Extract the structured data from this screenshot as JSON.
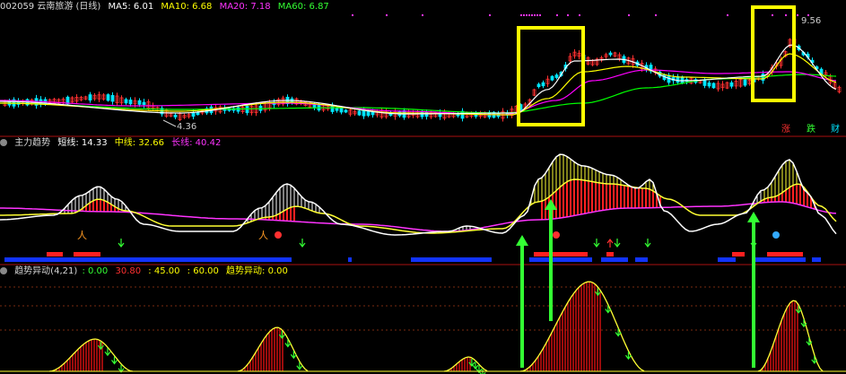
{
  "header1": {
    "code_name": "002059 云南旅游 (日线)",
    "ma5": "MA5: 6.01",
    "ma10": "MA10: 6.68",
    "ma20": "MA20: 7.18",
    "ma60": "MA60: 6.87"
  },
  "header2": {
    "name": "主力趋势",
    "short": "短线: 14.33",
    "mid": "中线: 32.66",
    "long": "长线: 40.42"
  },
  "header3": {
    "name": "趋势异动(4,21)",
    "v1": ": 0.00",
    "v2": "30.80",
    "v3": ": 45.00",
    "v4": ": 60.00",
    "v5": "趋势异动: 0.00"
  },
  "price_labels": {
    "low": "4.36",
    "high": "9.56"
  },
  "corner_buttons": [
    "涨",
    "跌",
    "财"
  ],
  "colors": {
    "up": "#ff3030",
    "down": "#00e5ff",
    "ma5": "#ffffff",
    "ma10": "#ffff00",
    "ma20": "#ff00ff",
    "ma60": "#00ff00",
    "highlight": "#ffff00",
    "arrow": "#33ff33"
  },
  "chart_data": [
    {
      "type": "candlestick",
      "title": "002059 云南旅游 (日线)",
      "series": [
        {
          "name": "MA5",
          "value": 6.01
        },
        {
          "name": "MA10",
          "value": 6.68
        },
        {
          "name": "MA20",
          "value": 7.18
        },
        {
          "name": "MA60",
          "value": 6.87
        }
      ],
      "annotations": [
        "4.36",
        "9.56"
      ]
    },
    {
      "type": "line",
      "title": "主力趋势",
      "series": [
        {
          "name": "短线",
          "value": 14.33
        },
        {
          "name": "中线",
          "value": 32.66
        },
        {
          "name": "长线",
          "value": 40.42
        }
      ]
    },
    {
      "type": "area",
      "title": "趋势异动(4,21)",
      "reference_levels": [
        0,
        30.8,
        45,
        60
      ],
      "series": [
        {
          "name": "趋势异动",
          "value": 0
        }
      ]
    }
  ]
}
